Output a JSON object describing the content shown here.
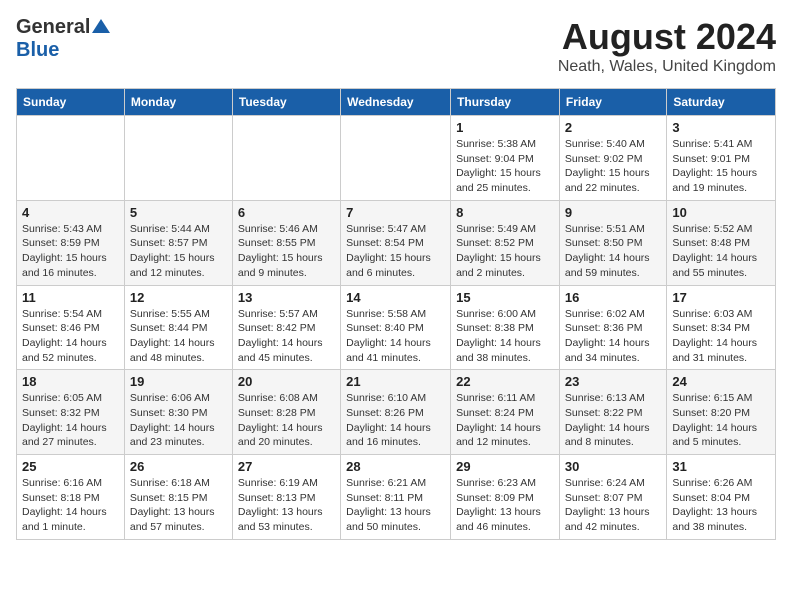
{
  "header": {
    "logo_general": "General",
    "logo_blue": "Blue",
    "month_year": "August 2024",
    "location": "Neath, Wales, United Kingdom"
  },
  "weekdays": [
    "Sunday",
    "Monday",
    "Tuesday",
    "Wednesday",
    "Thursday",
    "Friday",
    "Saturday"
  ],
  "weeks": [
    [
      {
        "day": "",
        "detail": ""
      },
      {
        "day": "",
        "detail": ""
      },
      {
        "day": "",
        "detail": ""
      },
      {
        "day": "",
        "detail": ""
      },
      {
        "day": "1",
        "detail": "Sunrise: 5:38 AM\nSunset: 9:04 PM\nDaylight: 15 hours\nand 25 minutes."
      },
      {
        "day": "2",
        "detail": "Sunrise: 5:40 AM\nSunset: 9:02 PM\nDaylight: 15 hours\nand 22 minutes."
      },
      {
        "day": "3",
        "detail": "Sunrise: 5:41 AM\nSunset: 9:01 PM\nDaylight: 15 hours\nand 19 minutes."
      }
    ],
    [
      {
        "day": "4",
        "detail": "Sunrise: 5:43 AM\nSunset: 8:59 PM\nDaylight: 15 hours\nand 16 minutes."
      },
      {
        "day": "5",
        "detail": "Sunrise: 5:44 AM\nSunset: 8:57 PM\nDaylight: 15 hours\nand 12 minutes."
      },
      {
        "day": "6",
        "detail": "Sunrise: 5:46 AM\nSunset: 8:55 PM\nDaylight: 15 hours\nand 9 minutes."
      },
      {
        "day": "7",
        "detail": "Sunrise: 5:47 AM\nSunset: 8:54 PM\nDaylight: 15 hours\nand 6 minutes."
      },
      {
        "day": "8",
        "detail": "Sunrise: 5:49 AM\nSunset: 8:52 PM\nDaylight: 15 hours\nand 2 minutes."
      },
      {
        "day": "9",
        "detail": "Sunrise: 5:51 AM\nSunset: 8:50 PM\nDaylight: 14 hours\nand 59 minutes."
      },
      {
        "day": "10",
        "detail": "Sunrise: 5:52 AM\nSunset: 8:48 PM\nDaylight: 14 hours\nand 55 minutes."
      }
    ],
    [
      {
        "day": "11",
        "detail": "Sunrise: 5:54 AM\nSunset: 8:46 PM\nDaylight: 14 hours\nand 52 minutes."
      },
      {
        "day": "12",
        "detail": "Sunrise: 5:55 AM\nSunset: 8:44 PM\nDaylight: 14 hours\nand 48 minutes."
      },
      {
        "day": "13",
        "detail": "Sunrise: 5:57 AM\nSunset: 8:42 PM\nDaylight: 14 hours\nand 45 minutes."
      },
      {
        "day": "14",
        "detail": "Sunrise: 5:58 AM\nSunset: 8:40 PM\nDaylight: 14 hours\nand 41 minutes."
      },
      {
        "day": "15",
        "detail": "Sunrise: 6:00 AM\nSunset: 8:38 PM\nDaylight: 14 hours\nand 38 minutes."
      },
      {
        "day": "16",
        "detail": "Sunrise: 6:02 AM\nSunset: 8:36 PM\nDaylight: 14 hours\nand 34 minutes."
      },
      {
        "day": "17",
        "detail": "Sunrise: 6:03 AM\nSunset: 8:34 PM\nDaylight: 14 hours\nand 31 minutes."
      }
    ],
    [
      {
        "day": "18",
        "detail": "Sunrise: 6:05 AM\nSunset: 8:32 PM\nDaylight: 14 hours\nand 27 minutes."
      },
      {
        "day": "19",
        "detail": "Sunrise: 6:06 AM\nSunset: 8:30 PM\nDaylight: 14 hours\nand 23 minutes."
      },
      {
        "day": "20",
        "detail": "Sunrise: 6:08 AM\nSunset: 8:28 PM\nDaylight: 14 hours\nand 20 minutes."
      },
      {
        "day": "21",
        "detail": "Sunrise: 6:10 AM\nSunset: 8:26 PM\nDaylight: 14 hours\nand 16 minutes."
      },
      {
        "day": "22",
        "detail": "Sunrise: 6:11 AM\nSunset: 8:24 PM\nDaylight: 14 hours\nand 12 minutes."
      },
      {
        "day": "23",
        "detail": "Sunrise: 6:13 AM\nSunset: 8:22 PM\nDaylight: 14 hours\nand 8 minutes."
      },
      {
        "day": "24",
        "detail": "Sunrise: 6:15 AM\nSunset: 8:20 PM\nDaylight: 14 hours\nand 5 minutes."
      }
    ],
    [
      {
        "day": "25",
        "detail": "Sunrise: 6:16 AM\nSunset: 8:18 PM\nDaylight: 14 hours\nand 1 minute."
      },
      {
        "day": "26",
        "detail": "Sunrise: 6:18 AM\nSunset: 8:15 PM\nDaylight: 13 hours\nand 57 minutes."
      },
      {
        "day": "27",
        "detail": "Sunrise: 6:19 AM\nSunset: 8:13 PM\nDaylight: 13 hours\nand 53 minutes."
      },
      {
        "day": "28",
        "detail": "Sunrise: 6:21 AM\nSunset: 8:11 PM\nDaylight: 13 hours\nand 50 minutes."
      },
      {
        "day": "29",
        "detail": "Sunrise: 6:23 AM\nSunset: 8:09 PM\nDaylight: 13 hours\nand 46 minutes."
      },
      {
        "day": "30",
        "detail": "Sunrise: 6:24 AM\nSunset: 8:07 PM\nDaylight: 13 hours\nand 42 minutes."
      },
      {
        "day": "31",
        "detail": "Sunrise: 6:26 AM\nSunset: 8:04 PM\nDaylight: 13 hours\nand 38 minutes."
      }
    ]
  ]
}
